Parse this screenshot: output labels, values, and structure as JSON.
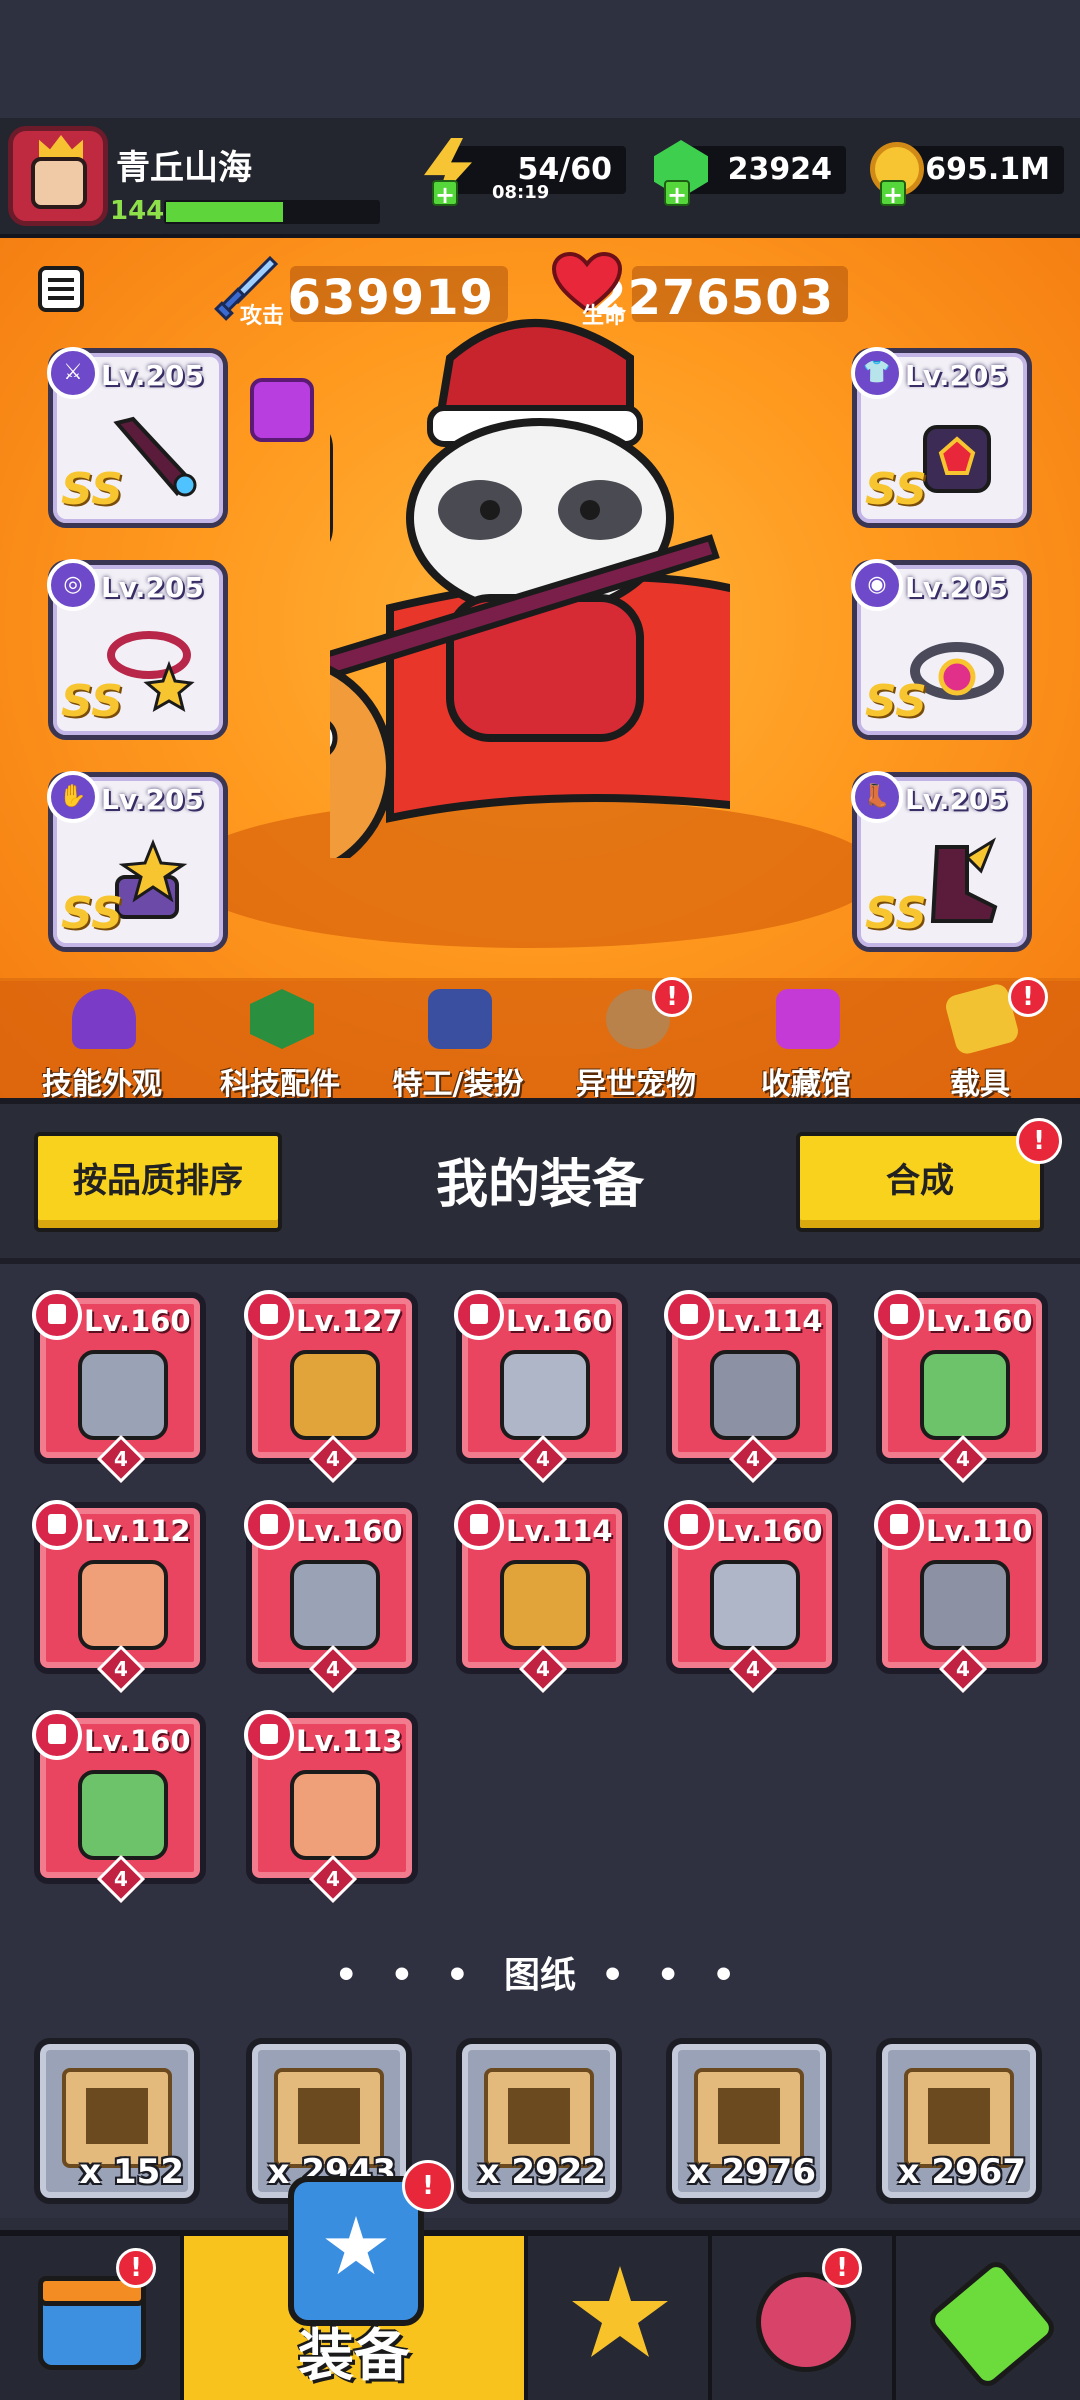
{
  "player": {
    "name": "青丘山海",
    "level": "144",
    "xp_fraction": 0.55
  },
  "resources": {
    "energy": {
      "value": "54/60",
      "timer": "08:19"
    },
    "gems": {
      "value": "23924"
    },
    "gold": {
      "value": "695.1M"
    }
  },
  "stats": {
    "attack_label": "攻击",
    "attack_value": "639919",
    "hp_label": "生命",
    "hp_value": "2276503"
  },
  "equipped": {
    "left": [
      {
        "level": "Lv.205",
        "grade": "SS",
        "slot": "weapon"
      },
      {
        "level": "Lv.205",
        "grade": "SS",
        "slot": "necklace"
      },
      {
        "level": "Lv.205",
        "grade": "SS",
        "slot": "gloves"
      }
    ],
    "right": [
      {
        "level": "Lv.205",
        "grade": "SS",
        "slot": "armor"
      },
      {
        "level": "Lv.205",
        "grade": "SS",
        "slot": "belt"
      },
      {
        "level": "Lv.205",
        "grade": "SS",
        "slot": "boots"
      }
    ]
  },
  "nav": [
    {
      "label": "技能外观",
      "icon": "hat-icon",
      "alert": false
    },
    {
      "label": "科技配件",
      "icon": "tech-chip-icon",
      "alert": false
    },
    {
      "label": "特工/装扮",
      "icon": "agent-icon",
      "alert": false
    },
    {
      "label": "异世宠物",
      "icon": "pet-icon",
      "alert": true
    },
    {
      "label": "收藏馆",
      "icon": "collection-chest-icon",
      "alert": false
    },
    {
      "label": "载具",
      "icon": "vehicle-icon",
      "alert": true
    }
  ],
  "panel": {
    "sort_button": "按品质排序",
    "title": "我的装备",
    "merge_button": "合成",
    "merge_alert": "!"
  },
  "inventory": [
    {
      "level": "Lv.160",
      "count": "4",
      "item": "kunai"
    },
    {
      "level": "Lv.127",
      "count": "4",
      "item": "torch"
    },
    {
      "level": "Lv.160",
      "count": "4",
      "item": "armor-plate"
    },
    {
      "level": "Lv.114",
      "count": "4",
      "item": "chest-armor"
    },
    {
      "level": "Lv.160",
      "count": "4",
      "item": "emerald-necklace"
    },
    {
      "level": "Lv.112",
      "count": "4",
      "item": "fang-necklace"
    },
    {
      "level": "Lv.160",
      "count": "4",
      "item": "gem-ring-belt"
    },
    {
      "level": "Lv.114",
      "count": "4",
      "item": "star-belt"
    },
    {
      "level": "Lv.160",
      "count": "4",
      "item": "claw-glove"
    },
    {
      "level": "Lv.110",
      "count": "4",
      "item": "mech-glove"
    },
    {
      "level": "Lv.160",
      "count": "4",
      "item": "thorn-boots"
    },
    {
      "level": "Lv.113",
      "count": "4",
      "item": "steel-boots"
    }
  ],
  "blueprints_label": "图纸",
  "blueprints": [
    {
      "count": "x 152",
      "icon": "gun-icon"
    },
    {
      "count": "x 2943",
      "icon": "shirt-icon"
    },
    {
      "count": "x 2922",
      "icon": "necklace-icon"
    },
    {
      "count": "x 2976",
      "icon": "belt-icon"
    },
    {
      "count": "x 2967",
      "icon": "glove-icon"
    }
  ],
  "tabs": [
    {
      "label": "",
      "icon": "shop-icon",
      "alert": true
    },
    {
      "label": "装备",
      "icon": "equipment-icon",
      "alert": true,
      "active": true
    },
    {
      "label": "",
      "icon": "battle-star-icon",
      "alert": false
    },
    {
      "label": "",
      "icon": "planet-icon",
      "alert": true
    },
    {
      "label": "",
      "icon": "dna-capsule-icon",
      "alert": false
    }
  ],
  "colors": {
    "accent_orange": "#ff9a1f",
    "button_yellow": "#f8d21c",
    "card_red": "#ea4560",
    "alert_red": "#e8283a"
  }
}
